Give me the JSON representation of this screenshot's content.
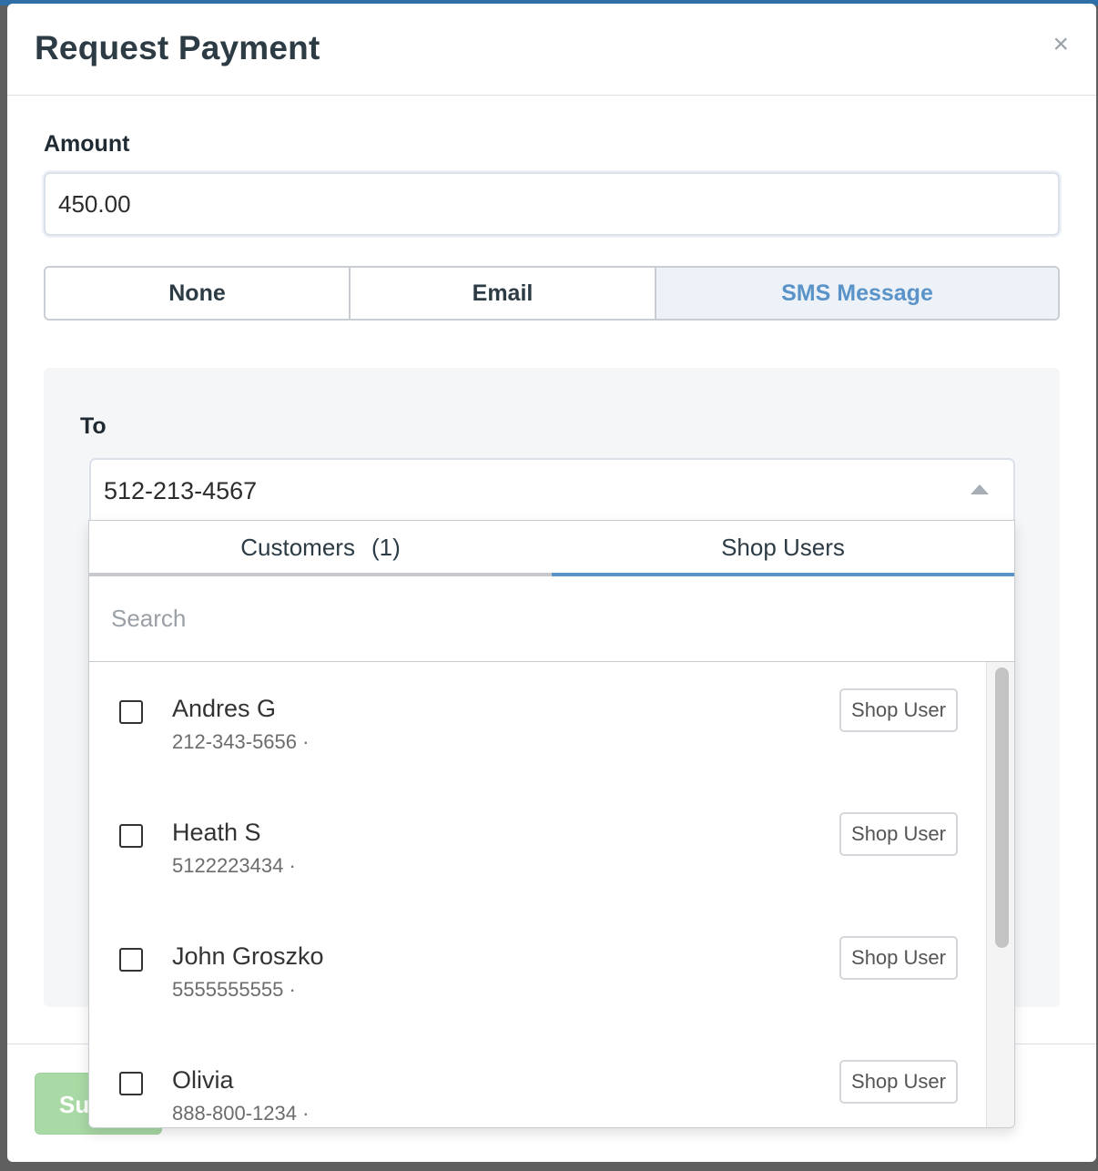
{
  "modal": {
    "title": "Request Payment",
    "close_glyph": "×",
    "close_icon": "close-icon"
  },
  "amount": {
    "label": "Amount",
    "value": "450.00"
  },
  "delivery_options": {
    "options": [
      "None",
      "Email",
      "SMS Message"
    ],
    "selected": "SMS Message"
  },
  "sms": {
    "to_label": "To",
    "recipient_value": "512-213-4567",
    "tabs": [
      {
        "label": "Customers",
        "count": "(1)"
      },
      {
        "label": "Shop Users",
        "count": ""
      }
    ],
    "active_tab": "Shop Users",
    "search_placeholder": "Search",
    "users": [
      {
        "name": "Andres G",
        "phone": "212-343-5656 ·",
        "role": "Shop User"
      },
      {
        "name": "Heath S",
        "phone": "5122223434 ·",
        "role": "Shop User"
      },
      {
        "name": "John Groszko",
        "phone": "5555555555 ·",
        "role": "Shop User"
      },
      {
        "name": "Olivia",
        "phone": "888-800-1234 ·",
        "role": "Shop User"
      }
    ]
  },
  "footer": {
    "submit_label_visible": "Su"
  },
  "colors": {
    "accent": "#5a93c8",
    "submit_disabled": "#a9d9a4",
    "title_text": "#2d3b45"
  }
}
